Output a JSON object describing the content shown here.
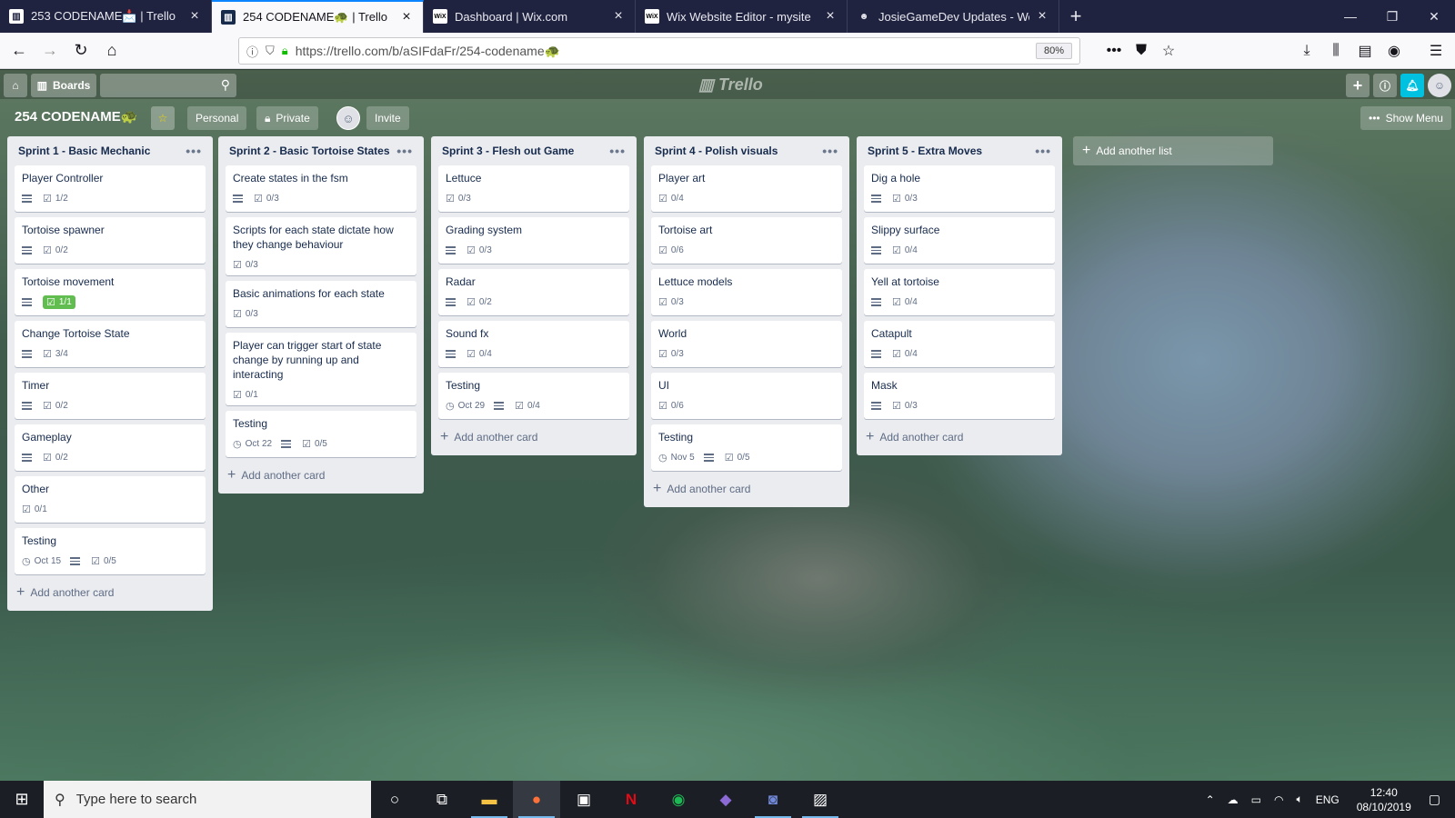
{
  "browser": {
    "tabs": [
      {
        "label": "253 CODENAME📩 | Trello",
        "icon": "trello-icon",
        "active": false
      },
      {
        "label": "254 CODENAME🐢 | Trello",
        "icon": "trello-icon",
        "active": true
      },
      {
        "label": "Dashboard | Wix.com",
        "icon": "wix-icon",
        "active": false
      },
      {
        "label": "Wix Website Editor - mysite",
        "icon": "wix-icon",
        "active": false
      },
      {
        "label": "JosieGameDev Updates - Week",
        "icon": "cat-icon",
        "active": false
      }
    ],
    "url": "https://trello.com/b/aSIFdaFr/254-codename🐢",
    "zoom": "80%"
  },
  "trello": {
    "boards_label": "Boards",
    "logo": "Trello",
    "board_title": "254 CODENAME🐢",
    "personal_label": "Personal",
    "private_label": "Private",
    "invite_label": "Invite",
    "show_menu_label": "Show Menu",
    "add_card_label": "Add another card",
    "add_list_label": "Add another list",
    "lists": [
      {
        "title": "Sprint 1 - Basic Mechanic",
        "cards": [
          {
            "title": "Player Controller",
            "desc": true,
            "checklist": "1/2"
          },
          {
            "title": "Tortoise spawner",
            "desc": true,
            "checklist": "0/2"
          },
          {
            "title": "Tortoise movement",
            "desc": true,
            "checklist": "1/1",
            "complete": true
          },
          {
            "title": "Change Tortoise State",
            "desc": true,
            "checklist": "3/4"
          },
          {
            "title": "Timer",
            "desc": true,
            "checklist": "0/2"
          },
          {
            "title": "Gameplay",
            "desc": true,
            "checklist": "0/2"
          },
          {
            "title": "Other",
            "desc": false,
            "checklist": "0/1"
          },
          {
            "title": "Testing",
            "due": "Oct 15",
            "desc": true,
            "checklist": "0/5"
          }
        ]
      },
      {
        "title": "Sprint 2 - Basic Tortoise States",
        "cards": [
          {
            "title": "Create states in the fsm",
            "desc": true,
            "checklist": "0/3"
          },
          {
            "title": "Scripts for each state dictate how they change behaviour",
            "desc": false,
            "checklist": "0/3"
          },
          {
            "title": "Basic animations for each state",
            "desc": false,
            "checklist": "0/3"
          },
          {
            "title": "Player can trigger start of state change by running up and interacting",
            "desc": false,
            "checklist": "0/1"
          },
          {
            "title": "Testing",
            "due": "Oct 22",
            "desc": true,
            "checklist": "0/5"
          }
        ]
      },
      {
        "title": "Sprint 3 - Flesh out Game",
        "cards": [
          {
            "title": "Lettuce",
            "desc": false,
            "checklist": "0/3"
          },
          {
            "title": "Grading system",
            "desc": true,
            "checklist": "0/3"
          },
          {
            "title": "Radar",
            "desc": true,
            "checklist": "0/2"
          },
          {
            "title": "Sound fx",
            "desc": true,
            "checklist": "0/4"
          },
          {
            "title": "Testing",
            "due": "Oct 29",
            "desc": true,
            "checklist": "0/4"
          }
        ]
      },
      {
        "title": "Sprint 4 - Polish visuals",
        "cards": [
          {
            "title": "Player art",
            "desc": false,
            "checklist": "0/4"
          },
          {
            "title": "Tortoise art",
            "desc": false,
            "checklist": "0/6"
          },
          {
            "title": "Lettuce models",
            "desc": false,
            "checklist": "0/3"
          },
          {
            "title": "World",
            "desc": false,
            "checklist": "0/3"
          },
          {
            "title": "UI",
            "desc": false,
            "checklist": "0/6"
          },
          {
            "title": "Testing",
            "due": "Nov 5",
            "desc": true,
            "checklist": "0/5"
          }
        ]
      },
      {
        "title": "Sprint 5 - Extra Moves",
        "cards": [
          {
            "title": "Dig a hole",
            "desc": true,
            "checklist": "0/3"
          },
          {
            "title": "Slippy surface",
            "desc": true,
            "checklist": "0/4"
          },
          {
            "title": "Yell at tortoise",
            "desc": true,
            "checklist": "0/4"
          },
          {
            "title": "Catapult",
            "desc": true,
            "checklist": "0/4"
          },
          {
            "title": "Mask",
            "desc": true,
            "checklist": "0/3"
          }
        ]
      }
    ]
  },
  "taskbar": {
    "search_placeholder": "Type here to search",
    "language": "ENG",
    "time": "12:40",
    "date": "08/10/2019"
  },
  "colors": {
    "tabbar": "#202340",
    "accent": "#0a84ff",
    "checklist_complete": "#61bd4f",
    "list_bg": "#ebecf0"
  }
}
